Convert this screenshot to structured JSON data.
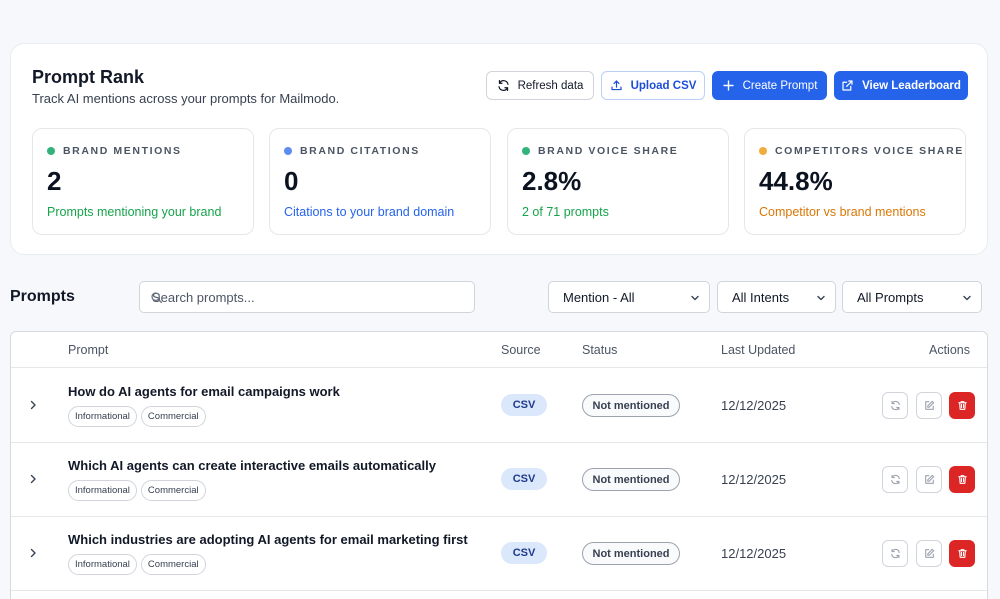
{
  "header": {
    "title": "Prompt Rank",
    "subtitle": "Track AI mentions across your prompts for Mailmodo.",
    "buttons": {
      "refresh": "Refresh data",
      "upload": "Upload CSV",
      "create": "Create Prompt",
      "leaderboard": "View Leaderboard"
    }
  },
  "stats": [
    {
      "label": "BRAND MENTIONS",
      "value": "2",
      "desc": "Prompts mentioning your brand",
      "dot_color": "#34b27b",
      "desc_color": "#16a34a"
    },
    {
      "label": "BRAND CITATIONS",
      "value": "0",
      "desc": "Citations to your brand domain",
      "dot_color": "#5b8def",
      "desc_color": "#2563eb"
    },
    {
      "label": "BRAND VOICE SHARE",
      "value": "2.8%",
      "desc": "2 of 71 prompts",
      "dot_color": "#34b27b",
      "desc_color": "#16a34a"
    },
    {
      "label": "COMPETITORS VOICE SHARE",
      "value": "44.8%",
      "desc": "Competitor vs brand mentions",
      "dot_color": "#f0ad3e",
      "desc_color": "#d97706"
    }
  ],
  "prompts_section": {
    "title": "Prompts",
    "search_placeholder": "Search prompts...",
    "filters": {
      "mention": "Mention - All",
      "intents": "All Intents",
      "prompts": "All Prompts"
    }
  },
  "table": {
    "headers": {
      "prompt": "Prompt",
      "source": "Source",
      "status": "Status",
      "last_updated": "Last Updated",
      "actions": "Actions"
    },
    "rows": [
      {
        "prompt": "How do AI agents for email campaigns work",
        "tags": [
          "Informational",
          "Commercial"
        ],
        "source": "CSV",
        "status": "Not mentioned",
        "last_updated": "12/12/2025"
      },
      {
        "prompt": "Which AI agents can create interactive emails automatically",
        "tags": [
          "Informational",
          "Commercial"
        ],
        "source": "CSV",
        "status": "Not mentioned",
        "last_updated": "12/12/2025"
      },
      {
        "prompt": "Which industries are adopting AI agents for email marketing first",
        "tags": [
          "Informational",
          "Commercial"
        ],
        "source": "CSV",
        "status": "Not mentioned",
        "last_updated": "12/12/2025"
      }
    ]
  },
  "icons": {
    "refresh": "refresh-icon",
    "upload": "upload-icon",
    "create": "plus-icon",
    "leaderboard": "external-link-icon",
    "search": "search-icon",
    "expand": "chevron-right-icon",
    "sync": "sync-icon",
    "edit": "edit-icon",
    "delete": "trash-icon"
  },
  "colors": {
    "primary": "#2563eb",
    "danger": "#dc2626",
    "background": "#f6f8fb"
  }
}
